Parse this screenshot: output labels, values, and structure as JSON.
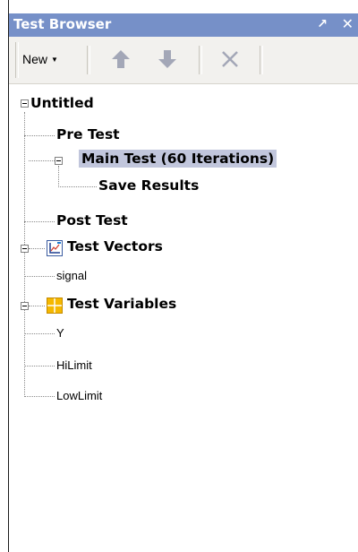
{
  "panel": {
    "title": "Test Browser"
  },
  "toolbar": {
    "new_label": "New"
  },
  "tree": {
    "root": "Untitled",
    "pre_test": "Pre Test",
    "main_test": "Main Test (60 Iterations)",
    "save_results": "Save Results",
    "post_test": "Post Test",
    "test_vectors": "Test Vectors",
    "vectors": [
      "signal"
    ],
    "test_variables": "Test Variables",
    "variables": [
      "Y",
      "HiLimit",
      "LowLimit"
    ]
  },
  "colors": {
    "titlebar": "#7690c8",
    "selection": "#c1c6dc",
    "arrow_icons": "#a3a7b7",
    "variables_icon": "#f5b800"
  }
}
